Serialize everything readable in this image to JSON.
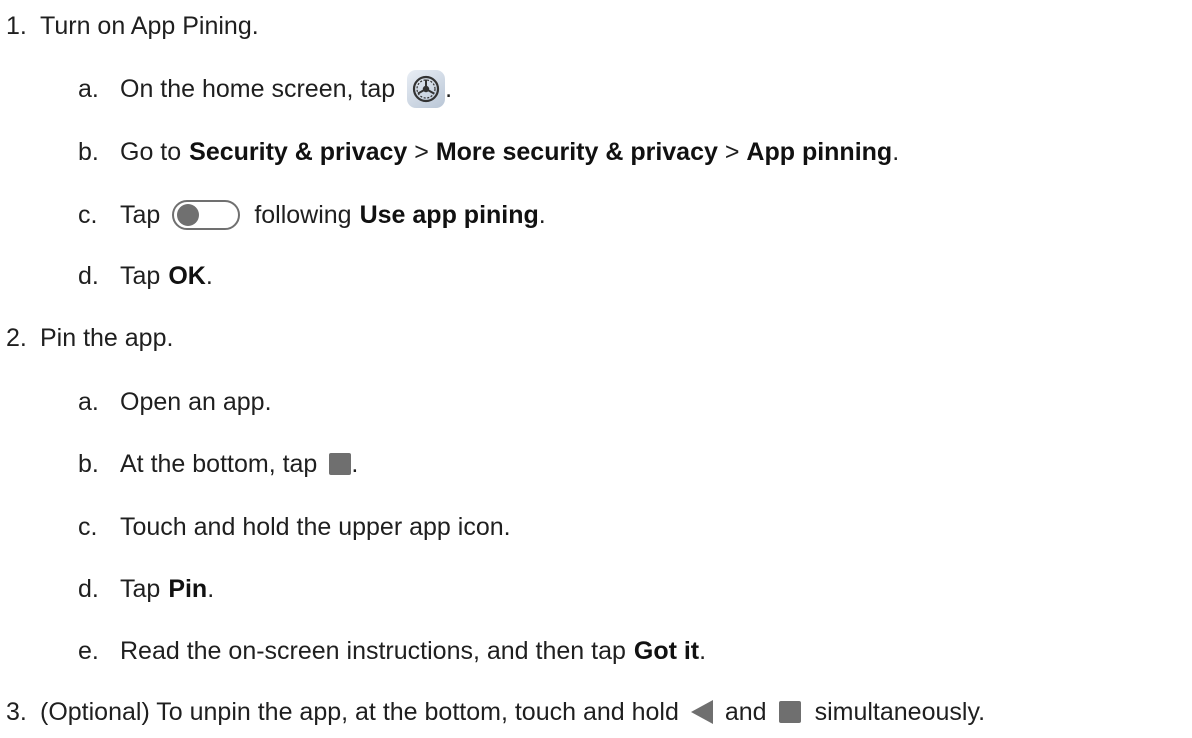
{
  "steps": [
    {
      "number": "1.",
      "text": "Turn on App Pining.",
      "substeps": [
        {
          "letter": "a.",
          "text_before": "On the home screen, tap",
          "text_after": "."
        },
        {
          "letter": "b.",
          "prefix": "Go to",
          "bold1": "Security & privacy",
          "sep1": " > ",
          "bold2": "More security & privacy",
          "sep2": " > ",
          "bold3": "App pinning",
          "suffix": "."
        },
        {
          "letter": "c.",
          "text_before": "Tap",
          "text_after": "following",
          "bold": "Use app pining",
          "suffix": "."
        },
        {
          "letter": "d.",
          "text_before": "Tap",
          "bold": "OK",
          "suffix": "."
        }
      ]
    },
    {
      "number": "2.",
      "text": "Pin the app.",
      "substeps": [
        {
          "letter": "a.",
          "text": "Open an app."
        },
        {
          "letter": "b.",
          "text_before": "At the bottom, tap",
          "text_after": "."
        },
        {
          "letter": "c.",
          "text": "Touch and hold the upper app icon."
        },
        {
          "letter": "d.",
          "text_before": "Tap",
          "bold": "Pin",
          "suffix": "."
        },
        {
          "letter": "e.",
          "text_before": "Read the on-screen instructions, and then tap",
          "bold": "Got it",
          "suffix": "."
        }
      ]
    },
    {
      "number": "3.",
      "text_before": "(Optional) To unpin the app, at the bottom, touch and hold",
      "text_mid": "and",
      "text_after": "simultaneously."
    }
  ],
  "icons": {
    "settings": "settings-gear-icon",
    "toggle": "toggle-off-icon",
    "recents": "recents-square-icon",
    "back": "back-triangle-icon"
  }
}
